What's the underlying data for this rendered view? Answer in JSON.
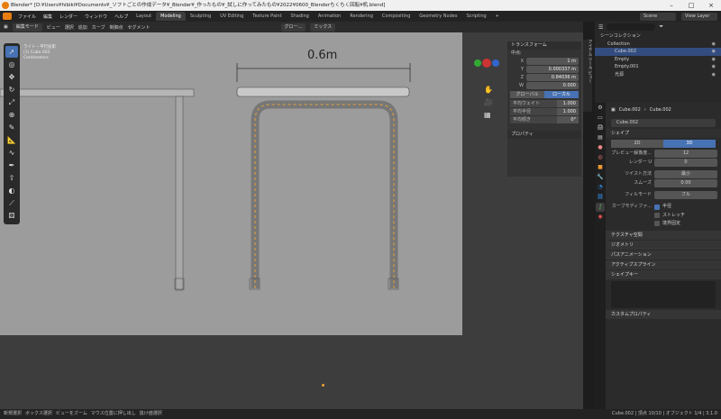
{
  "titlebar": {
    "title": "Blender* [D:¥Users¥hibiki¥Documents¥_ソフトごとの作成データ¥_Blender¥_作ったもの¥_試しに作ってみたもの¥2022¥0600_Blenderちくちく回転¥机.blend]"
  },
  "menubar": {
    "menus": [
      "ファイル",
      "編集",
      "レンダー",
      "ウィンドウ",
      "ヘルプ"
    ],
    "workspaces": [
      "Layout",
      "Modeling",
      "Sculpting",
      "UV Editing",
      "Texture Paint",
      "Shading",
      "Animation",
      "Rendering",
      "Compositing",
      "Geometry Nodes",
      "Scripting"
    ],
    "add_tab": "+",
    "scene_label": "Scene",
    "viewlayer_label": "View Layer"
  },
  "viewport_header": {
    "mode": "編集モード",
    "menus": [
      "ビュー",
      "選択",
      "追加",
      "カーブ",
      "制御点",
      "セグメント"
    ],
    "transform": "グロー...",
    "mix": "ミックス"
  },
  "viewport": {
    "overlay_lines": [
      "ライト・平行投影",
      "(1) Cube.002",
      "Centimeters"
    ],
    "dimension_label": "0.6m"
  },
  "toolbar": {
    "icons": [
      "select-icon",
      "cursor-icon",
      "move-icon",
      "rotate-icon",
      "scale-icon",
      "transform-icon",
      "annotate-icon",
      "measure-icon",
      "draw-icon",
      "pen-icon",
      "extrude-icon",
      "radius-icon",
      "tilt-icon",
      "randomize-icon"
    ]
  },
  "npanel": {
    "tabs": "アイテム ツール ビュー",
    "transform_title": "トランスフォーム",
    "median_label": "中点:",
    "coords": [
      {
        "label": "X",
        "value": "1 m"
      },
      {
        "label": "Y",
        "value": "0.000337 m"
      },
      {
        "label": "Z",
        "value": "0.84036 m"
      },
      {
        "label": "W",
        "value": "0.000"
      }
    ],
    "global": "グローバル",
    "local": "ローカル",
    "extra": [
      {
        "label": "平均ウェイト",
        "value": "1.000"
      },
      {
        "label": "平均半径",
        "value": "1.000"
      },
      {
        "label": "平均傾き",
        "value": "0°"
      }
    ],
    "properties": "プロパティ"
  },
  "outliner": {
    "root": "シーンコレクション",
    "items": [
      {
        "label": "Collection",
        "selected": false
      },
      {
        "label": "Cube.002",
        "selected": true
      },
      {
        "label": "Empty",
        "selected": false
      },
      {
        "label": "Empty.001",
        "selected": false
      },
      {
        "label": "光源",
        "selected": false
      }
    ]
  },
  "properties": {
    "breadcrumb": "Cube.002",
    "breadcrumb2": "Cube.002",
    "data_name": "Cube.002",
    "shape_section": "シェイプ",
    "dim_2d": "2D",
    "dim_3d": "3D",
    "rows": [
      {
        "label": "プレビュー解像度...",
        "value": "12"
      },
      {
        "label": "レンダー U",
        "value": "0"
      },
      {
        "label": "ツイスト方法",
        "value": "最小"
      },
      {
        "label": "スムーズ",
        "value": "0.00"
      },
      {
        "label": "フィルモード",
        "value": "フル"
      }
    ],
    "curve_deform": "カーブモディファ...",
    "checks": [
      {
        "label": "半径",
        "on": true
      },
      {
        "label": "ストレッチ",
        "on": false
      },
      {
        "label": "境界固定",
        "on": false
      }
    ],
    "sections": [
      "テクスチャ空間",
      "ジオメトリ",
      "パスアニメーション",
      "アクティブスプライン",
      "シェイプキー"
    ],
    "custom_props": "カスタムプロパティ"
  },
  "statusbar": {
    "items": [
      "新規選択",
      "ボックス選択",
      "ビューをズーム",
      "マウス位置に押し出し",
      "抜け値選択"
    ],
    "right": "Cube.002 | 頂点 10/10 | オブジェクト 1/4 | 3.1.0"
  }
}
